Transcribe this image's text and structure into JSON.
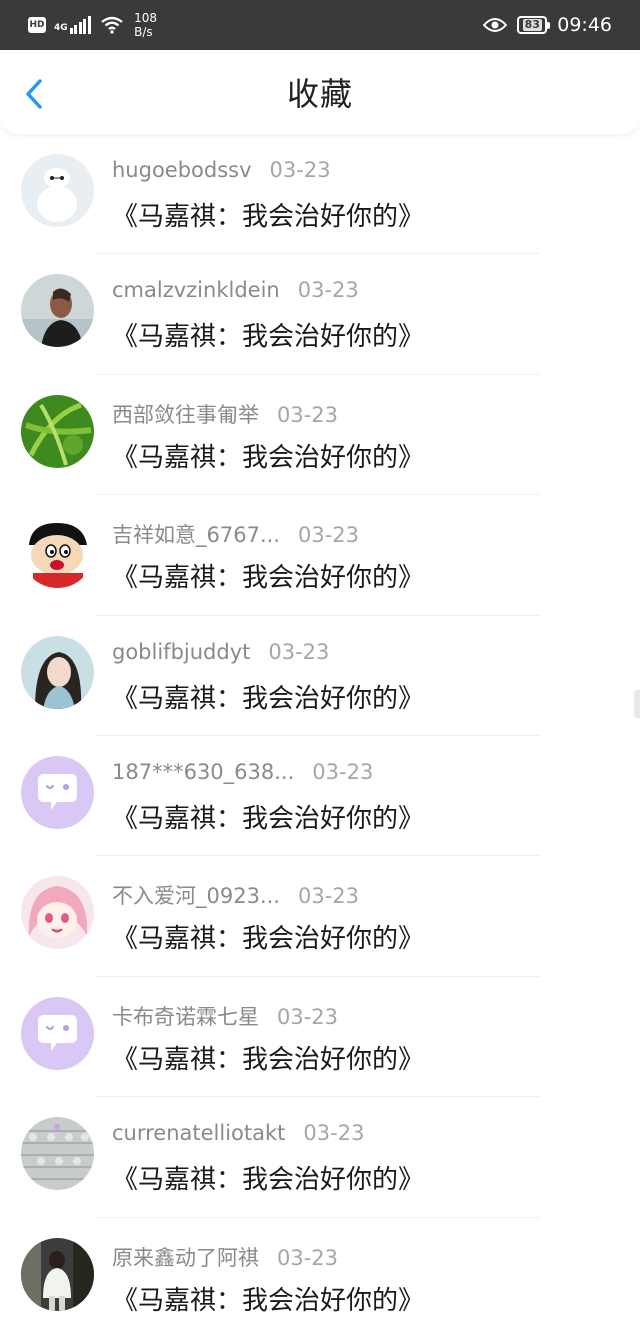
{
  "status_bar": {
    "hd": "HD",
    "network": "4G",
    "speed_value": "108",
    "speed_unit": "B/s",
    "battery": "83",
    "time": "09:46"
  },
  "header": {
    "title": "收藏",
    "back_icon": "chevron-left-icon",
    "accent_color": "#2196f3"
  },
  "items": [
    {
      "username": "hugoebodssv",
      "date": "03-23",
      "content": "《马嘉祺：我会治好你的》",
      "avatar": "white-robot"
    },
    {
      "username": "cmalzvzinkldein",
      "date": "03-23",
      "content": "《马嘉祺：我会治好你的》",
      "avatar": "man-photo"
    },
    {
      "username": "西部敛往事匍举",
      "date": "03-23",
      "content": "《马嘉祺：我会治好你的》",
      "avatar": "green-leaves"
    },
    {
      "username": "吉祥如意_6767...",
      "date": "03-23",
      "content": "《马嘉祺：我会治好你的》",
      "avatar": "cartoon-boy"
    },
    {
      "username": "goblifbjuddyt",
      "date": "03-23",
      "content": "《马嘉祺：我会治好你的》",
      "avatar": "girl-photo"
    },
    {
      "username": "187***630_638...",
      "date": "03-23",
      "content": "《马嘉祺：我会治好你的》",
      "avatar": "default-chat"
    },
    {
      "username": "不入爱河_0923...",
      "date": "03-23",
      "content": "《马嘉祺：我会治好你的》",
      "avatar": "anime-girl"
    },
    {
      "username": "卡布奇诺霖七星",
      "date": "03-23",
      "content": "《马嘉祺：我会治好你的》",
      "avatar": "default-chat"
    },
    {
      "username": "currenatelliotakt",
      "date": "03-23",
      "content": "《马嘉祺：我会治好你的》",
      "avatar": "knit-texture"
    },
    {
      "username": "原来鑫动了阿祺",
      "date": "03-23",
      "content": "《马嘉祺：我会治好你的》",
      "avatar": "street-photo"
    }
  ]
}
